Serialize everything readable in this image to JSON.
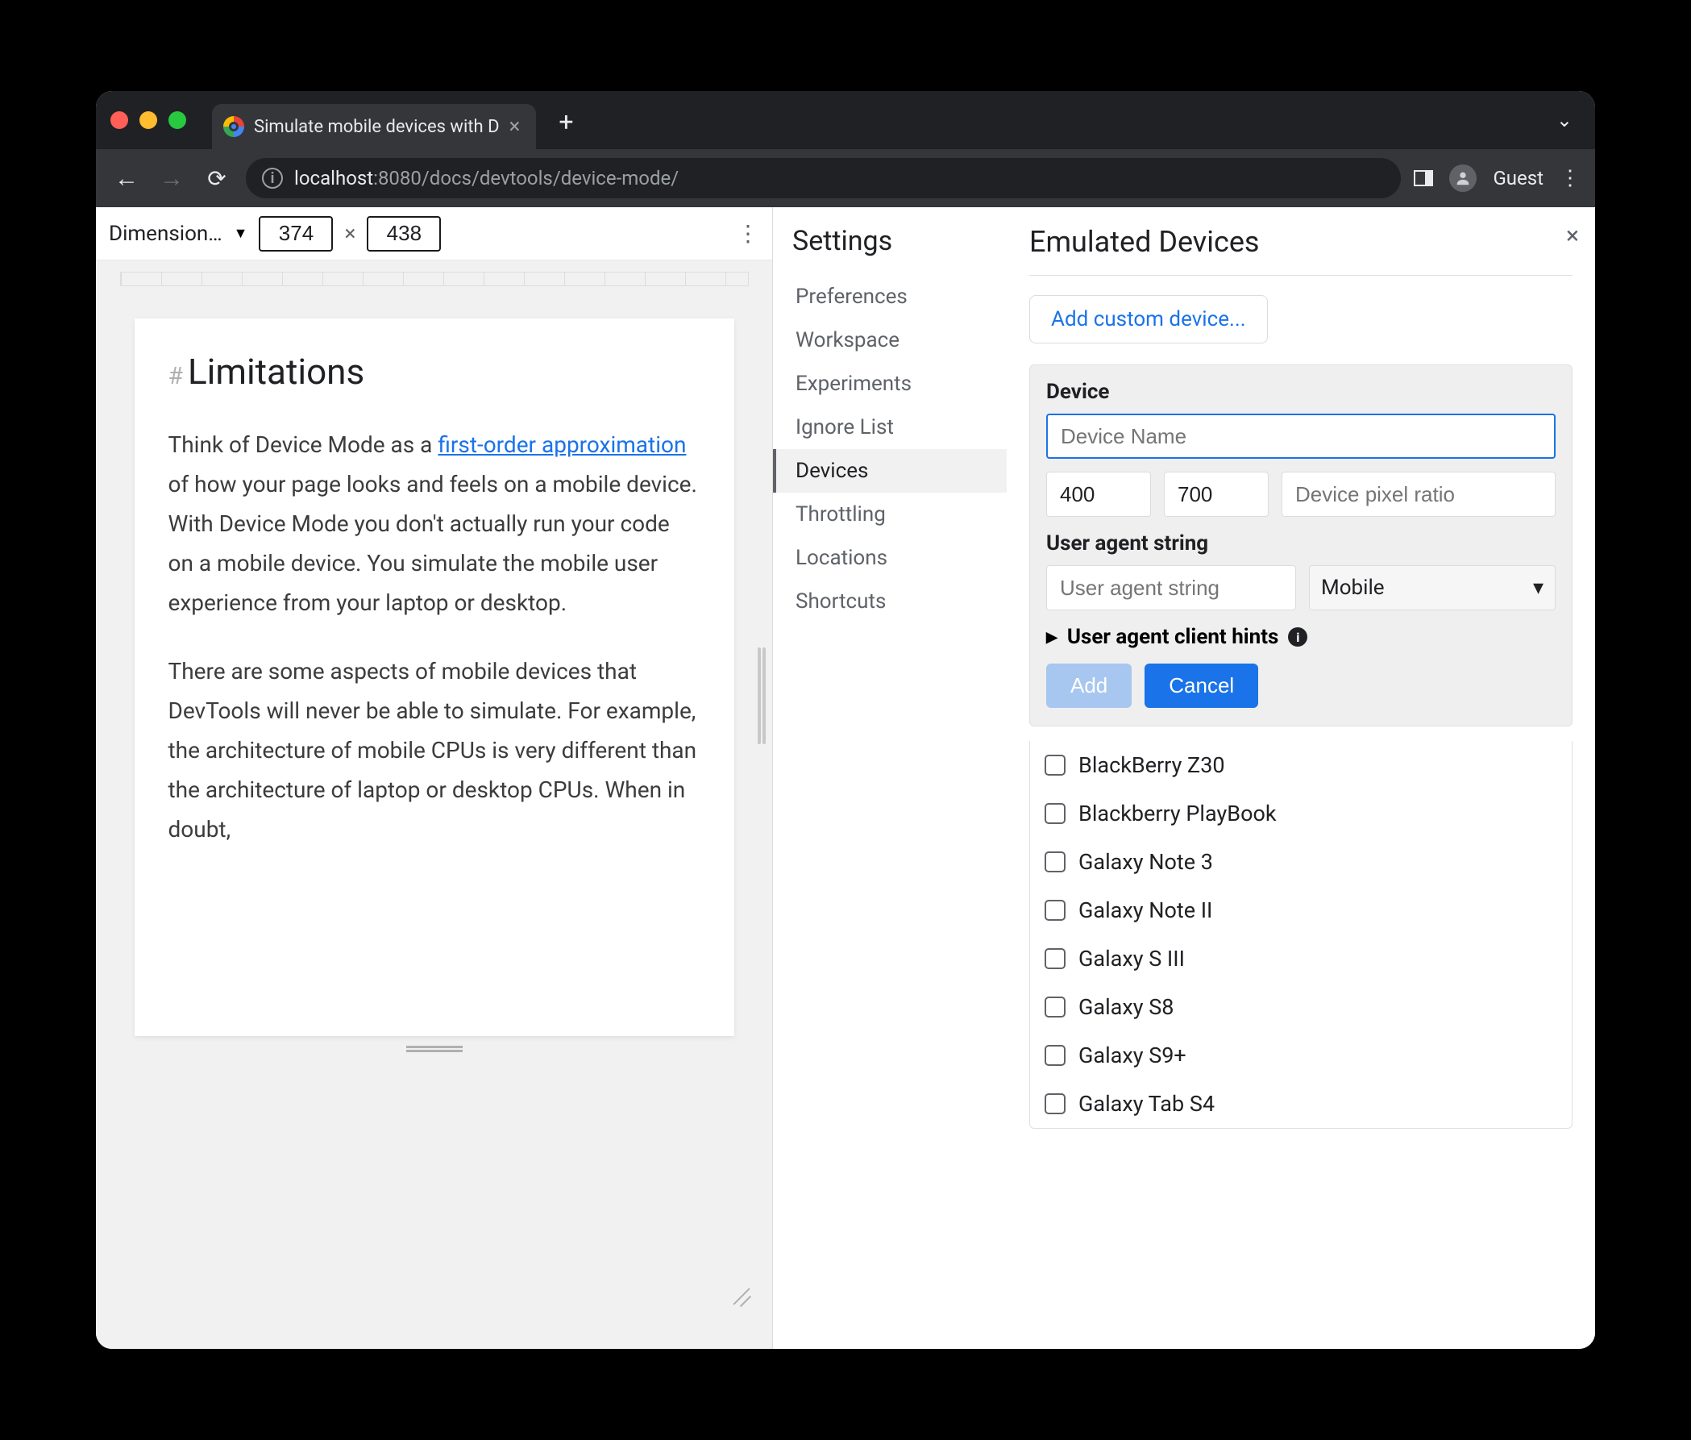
{
  "tab": {
    "title": "Simulate mobile devices with D"
  },
  "url": {
    "host": "localhost",
    "port": ":8080",
    "path": "/docs/devtools/device-mode/"
  },
  "guest_label": "Guest",
  "device_toolbar": {
    "dimensions_label": "Dimension…",
    "width": "374",
    "height": "438",
    "times": "×"
  },
  "page": {
    "heading": "Limitations",
    "p1_pre": "Think of Device Mode as a ",
    "p1_link": "first-order approximation",
    "p1_post": " of how your page looks and feels on a mobile device. With Device Mode you don't actually run your code on a mobile device. You simulate the mobile user experience from your laptop or desktop.",
    "p2": "There are some aspects of mobile devices that DevTools will never be able to simulate. For example, the architecture of mobile CPUs is very different than the architecture of laptop or desktop CPUs. When in doubt,"
  },
  "settings": {
    "title": "Settings",
    "items": [
      "Preferences",
      "Workspace",
      "Experiments",
      "Ignore List",
      "Devices",
      "Throttling",
      "Locations",
      "Shortcuts"
    ],
    "active_index": 4
  },
  "emulated": {
    "title": "Emulated Devices",
    "add_custom": "Add custom device...",
    "device_label": "Device",
    "device_name_placeholder": "Device Name",
    "width_value": "400",
    "height_value": "700",
    "dpr_placeholder": "Device pixel ratio",
    "ua_label": "User agent string",
    "ua_placeholder": "User agent string",
    "ua_type": "Mobile",
    "hints_label": "User agent client hints",
    "add_btn": "Add",
    "cancel_btn": "Cancel",
    "devices": [
      "BlackBerry Z30",
      "Blackberry PlayBook",
      "Galaxy Note 3",
      "Galaxy Note II",
      "Galaxy S III",
      "Galaxy S8",
      "Galaxy S9+",
      "Galaxy Tab S4"
    ]
  }
}
